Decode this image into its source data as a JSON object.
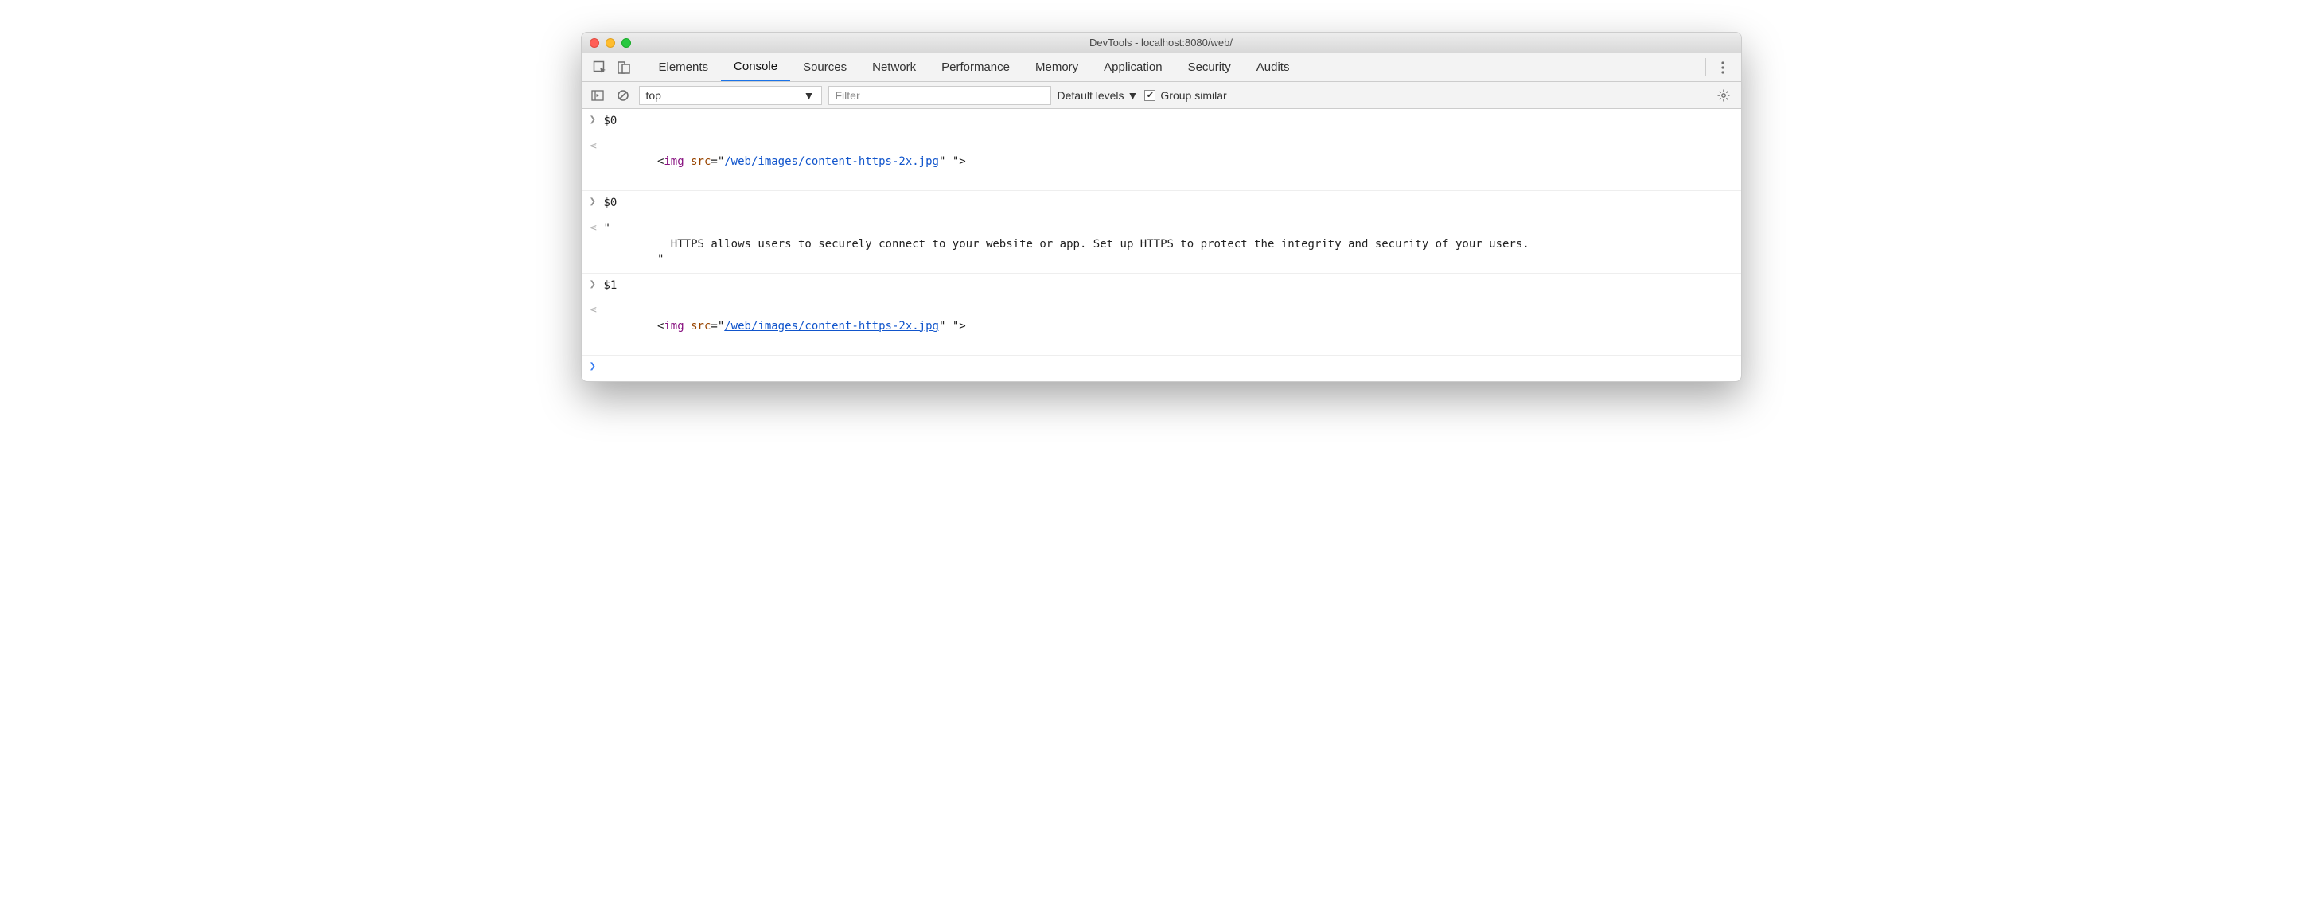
{
  "window": {
    "title": "DevTools - localhost:8080/web/"
  },
  "tabs": {
    "items": [
      "Elements",
      "Console",
      "Sources",
      "Network",
      "Performance",
      "Memory",
      "Application",
      "Security",
      "Audits"
    ],
    "active": "Console"
  },
  "toolbar": {
    "context": "top",
    "filter_placeholder": "Filter",
    "levels_label": "Default levels",
    "group_similar_label": "Group similar",
    "group_similar_checked": true
  },
  "console": {
    "entries": [
      {
        "kind": "input",
        "text": "$0"
      },
      {
        "kind": "output-img",
        "src": "/web/images/content-https-2x.jpg"
      },
      {
        "kind": "input",
        "text": "$0"
      },
      {
        "kind": "output-text",
        "text": "\"\n          HTTPS allows users to securely connect to your website or app. Set up HTTPS to protect the integrity and security of your users.\n        \""
      },
      {
        "kind": "input",
        "text": "$1"
      },
      {
        "kind": "output-img",
        "src": "/web/images/content-https-2x.jpg"
      }
    ]
  }
}
